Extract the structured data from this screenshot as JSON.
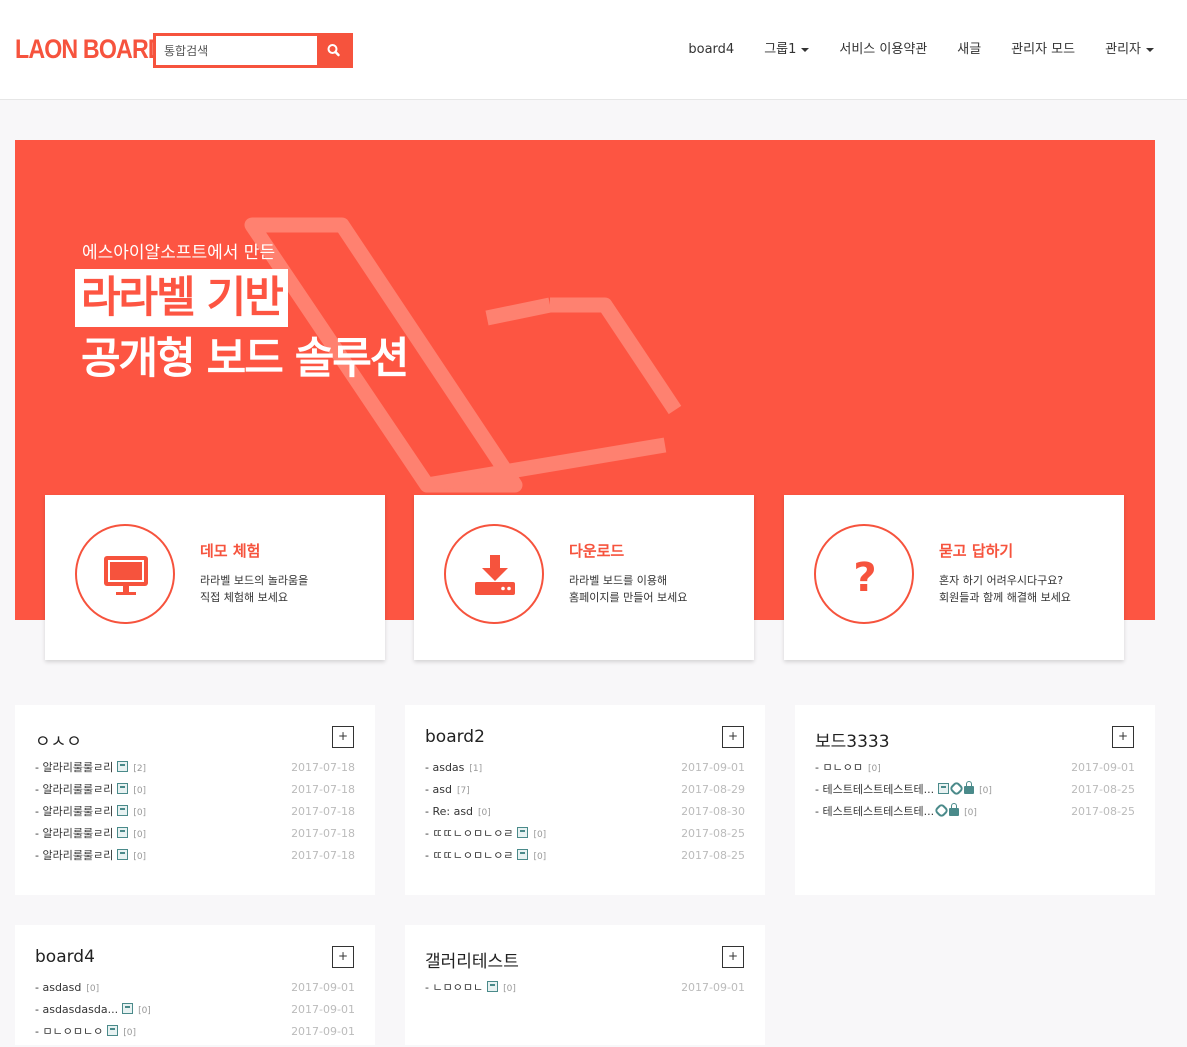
{
  "header": {
    "logo": "LAON BOARD",
    "search_placeholder": "통합검색",
    "nav": [
      {
        "label": "board4",
        "dropdown": false
      },
      {
        "label": "그룹1",
        "dropdown": true
      },
      {
        "label": "서비스 이용약관",
        "dropdown": false
      },
      {
        "label": "새글",
        "dropdown": false
      },
      {
        "label": "관리자 모드",
        "dropdown": false
      },
      {
        "label": "관리자",
        "dropdown": true
      }
    ]
  },
  "hero": {
    "pre": "에스아이알소프트에서 만든",
    "highlight": "라라벨 기반",
    "line2": "공개형 보드 솔루션",
    "accent": "#fd5542"
  },
  "cards": [
    {
      "icon": "monitor-icon",
      "title": "데모 체험",
      "desc1": "라라벨 보드의 놀라움을",
      "desc2": "직접 체험해 보세요"
    },
    {
      "icon": "download-icon",
      "title": "다운로드",
      "desc1": "라라벨 보드를 이용해",
      "desc2": "홈페이지를 만들어 보세요"
    },
    {
      "icon": "question-icon",
      "title": "묻고 답하기",
      "desc1": "혼자 하기 어려우시다구요?",
      "desc2": "회원들과 함께 해결해 보세요"
    }
  ],
  "widgets": [
    {
      "title": "ㅇㅅㅇ",
      "items": [
        {
          "title": "알라리룰룰ㄹ리",
          "icons": [
            "file"
          ],
          "count": "[2]",
          "date": "2017-07-18"
        },
        {
          "title": "알라리룰룰ㄹ리",
          "icons": [
            "file"
          ],
          "count": "[0]",
          "date": "2017-07-18"
        },
        {
          "title": "알라리룰룰ㄹ리",
          "icons": [
            "file"
          ],
          "count": "[0]",
          "date": "2017-07-18"
        },
        {
          "title": "알라리룰룰ㄹ리",
          "icons": [
            "file"
          ],
          "count": "[0]",
          "date": "2017-07-18"
        },
        {
          "title": "알라리룰룰ㄹ리",
          "icons": [
            "file"
          ],
          "count": "[0]",
          "date": "2017-07-18"
        }
      ]
    },
    {
      "title": "board2",
      "items": [
        {
          "title": "asdas",
          "icons": [],
          "count": "[1]",
          "date": "2017-09-01"
        },
        {
          "title": "asd",
          "icons": [],
          "count": "[7]",
          "date": "2017-08-29"
        },
        {
          "title": "Re: asd",
          "icons": [],
          "count": "[0]",
          "date": "2017-08-30"
        },
        {
          "title": "ㄸㄸㄴㅇㅁㄴㅇㄹ",
          "icons": [
            "file"
          ],
          "count": "[0]",
          "date": "2017-08-25"
        },
        {
          "title": "ㄸㄸㄴㅇㅁㄴㅇㄹ",
          "icons": [
            "file"
          ],
          "count": "[0]",
          "date": "2017-08-25"
        }
      ]
    },
    {
      "title": "보드3333",
      "items": [
        {
          "title": "ㅁㄴㅇㅁ",
          "icons": [],
          "count": "[0]",
          "date": "2017-09-01"
        },
        {
          "title": "테스트테스트테스트테...",
          "icons": [
            "file",
            "link",
            "lock"
          ],
          "count": "[0]",
          "date": "2017-08-25"
        },
        {
          "title": "테스트테스트테스트테...",
          "icons": [
            "link",
            "lock"
          ],
          "count": "[0]",
          "date": "2017-08-25"
        }
      ]
    },
    {
      "title": "board4",
      "items": [
        {
          "title": "asdasd",
          "icons": [],
          "count": "[0]",
          "date": "2017-09-01"
        },
        {
          "title": "asdasdasda...",
          "icons": [
            "file"
          ],
          "count": "[0]",
          "date": "2017-09-01"
        },
        {
          "title": "ㅁㄴㅇㅁㄴㅇ",
          "icons": [
            "file"
          ],
          "count": "[0]",
          "date": "2017-09-01"
        }
      ]
    },
    {
      "title": "갤러리테스트",
      "items": [
        {
          "title": "ㄴㅁㅇㅁㄴ",
          "icons": [
            "file"
          ],
          "count": "[0]",
          "date": "2017-09-01"
        }
      ]
    }
  ],
  "more_label": "+"
}
